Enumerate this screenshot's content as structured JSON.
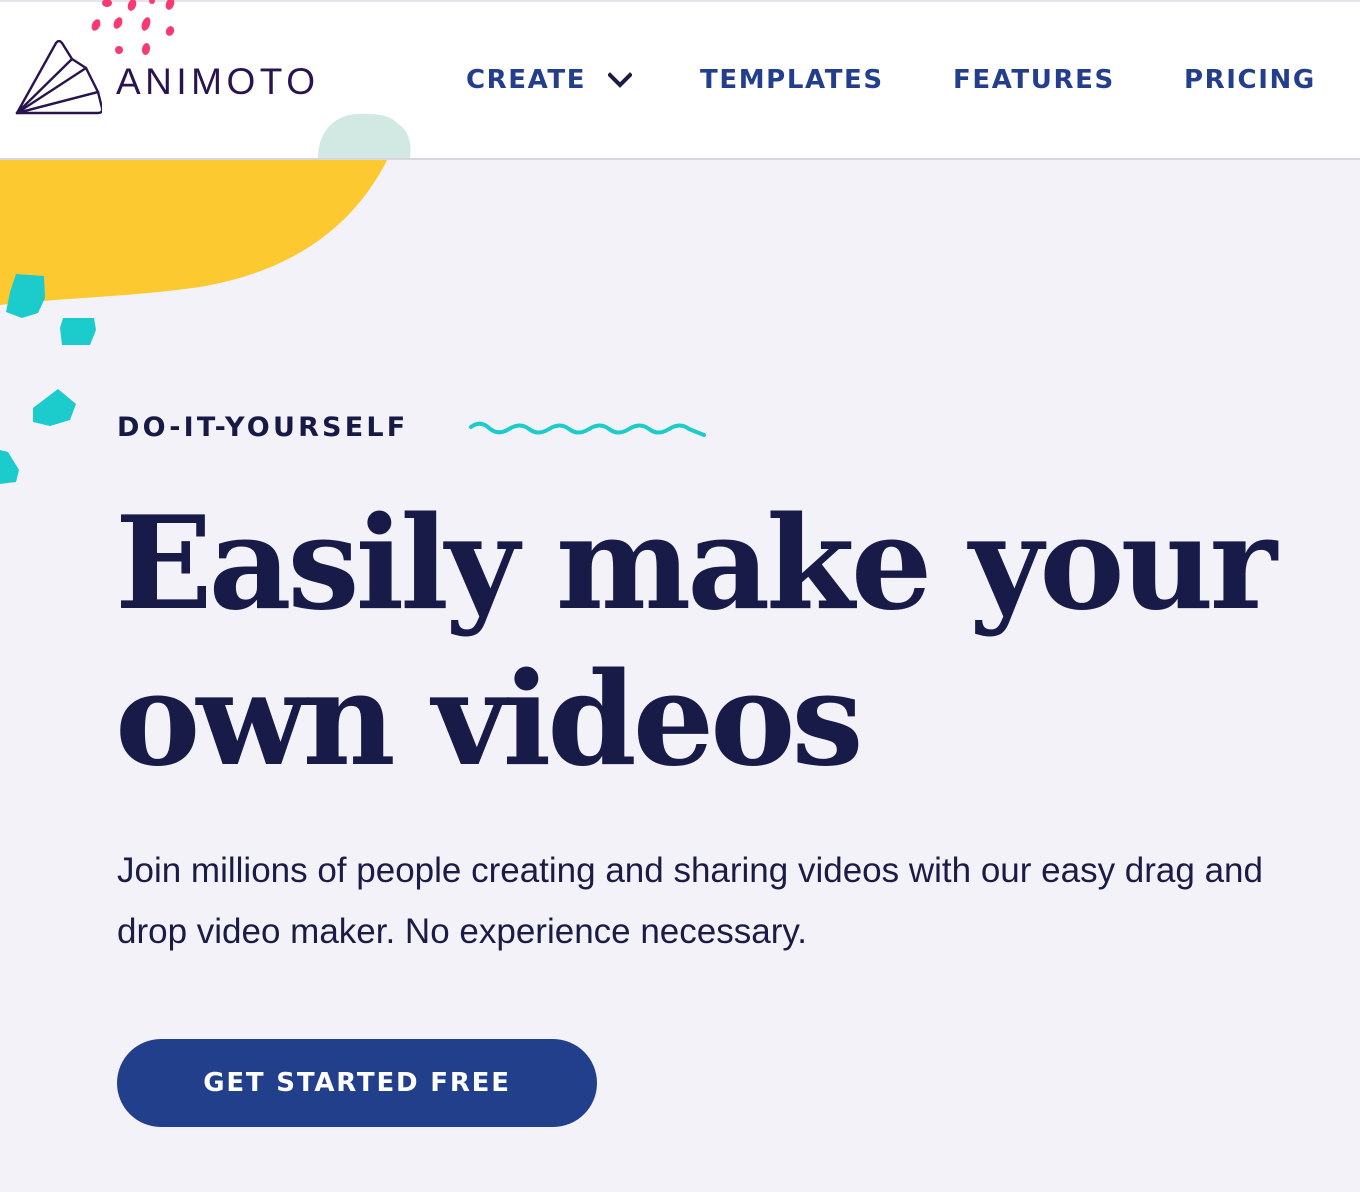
{
  "header": {
    "logo": {
      "icon": "animoto-fan-logo-icon",
      "text": "ANIMOTO"
    },
    "nav": [
      {
        "label": "CREATE",
        "has_dropdown": true,
        "icon": "chevron-down-icon"
      },
      {
        "label": "TEMPLATES"
      },
      {
        "label": "FEATURES"
      },
      {
        "label": "PRICING"
      }
    ]
  },
  "hero": {
    "eyebrow": "DO-IT-YOURSELF",
    "eyebrow_decoration": "wavy-line-icon",
    "headline_line1": "Easily make your",
    "headline_line2": "own videos",
    "subtext": "Join millions of people creating and sharing videos with our easy drag and drop video maker. No experience necessary.",
    "cta_label": "GET STARTED FREE"
  },
  "colors": {
    "brand_navy": "#181b48",
    "nav_blue": "#233e8c",
    "cta_blue": "#223f8c",
    "accent_yellow": "#fdc930",
    "accent_teal": "#1ccbcc",
    "accent_pink": "#f73a72",
    "accent_mint": "#d2e8e2",
    "hero_background": "#f2f2f8",
    "logo_purple": "#2a1450"
  }
}
